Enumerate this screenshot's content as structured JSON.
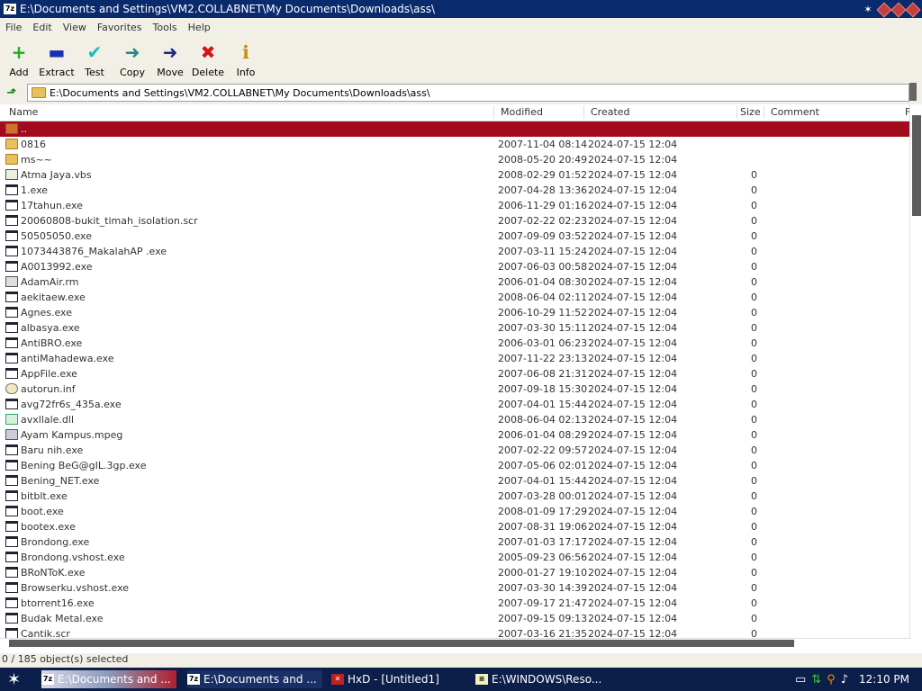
{
  "window": {
    "title": "E:\\Documents and Settings\\VM2.COLLABNET\\My Documents\\Downloads\\ass\\",
    "app_icon": "7z"
  },
  "menu": [
    "File",
    "Edit",
    "View",
    "Favorites",
    "Tools",
    "Help"
  ],
  "toolbar": [
    {
      "label": "Add",
      "icon": "+",
      "color": "#18b018"
    },
    {
      "label": "Extract",
      "icon": "▬",
      "color": "#1830b0"
    },
    {
      "label": "Test",
      "icon": "✔",
      "color": "#20b8b8"
    },
    {
      "label": "Copy",
      "icon": "➜",
      "color": "#208888"
    },
    {
      "label": "Move",
      "icon": "➜",
      "color": "#1a2a80"
    },
    {
      "label": "Delete",
      "icon": "✖",
      "color": "#d01818"
    },
    {
      "label": "Info",
      "icon": "ℹ",
      "color": "#c09000"
    }
  ],
  "address": {
    "path": "E:\\Documents and Settings\\VM2.COLLABNET\\My Documents\\Downloads\\ass\\"
  },
  "columns": {
    "name": "Name",
    "modified": "Modified",
    "created": "Created",
    "size": "Size",
    "comment": "Comment",
    "extra": "F"
  },
  "rows": [
    {
      "icon": "folder",
      "name": "..",
      "modified": "",
      "created": "",
      "size": ""
    },
    {
      "icon": "folder",
      "name": "0816",
      "modified": "2007-11-04 08:14",
      "created": "2024-07-15 12:04",
      "size": ""
    },
    {
      "icon": "folder",
      "name": "ms~~",
      "modified": "2008-05-20 20:49",
      "created": "2024-07-15 12:04",
      "size": ""
    },
    {
      "icon": "script",
      "name": " Atma Jaya.vbs",
      "modified": "2008-02-29 01:52",
      "created": "2024-07-15 12:04",
      "size": "0"
    },
    {
      "icon": "exe",
      "name": "1.exe",
      "modified": "2007-04-28 13:36",
      "created": "2024-07-15 12:04",
      "size": "0"
    },
    {
      "icon": "exe",
      "name": "17tahun.exe",
      "modified": "2006-11-29 01:16",
      "created": "2024-07-15 12:04",
      "size": "0"
    },
    {
      "icon": "exe",
      "name": "20060808-bukit_timah_isolation.scr",
      "modified": "2007-02-22 02:23",
      "created": "2024-07-15 12:04",
      "size": "0"
    },
    {
      "icon": "exe",
      "name": "50505050.exe",
      "modified": "2007-09-09 03:52",
      "created": "2024-07-15 12:04",
      "size": "0"
    },
    {
      "icon": "exe",
      "name": "1073443876_MakalahAP .exe",
      "modified": "2007-03-11 15:24",
      "created": "2024-07-15 12:04",
      "size": "0"
    },
    {
      "icon": "exe",
      "name": "A0013992.exe",
      "modified": "2007-06-03 00:58",
      "created": "2024-07-15 12:04",
      "size": "0"
    },
    {
      "icon": "rm",
      "name": "AdamAir.rm",
      "modified": "2006-01-04 08:30",
      "created": "2024-07-15 12:04",
      "size": "0"
    },
    {
      "icon": "exe",
      "name": "aekitaew.exe",
      "modified": "2008-06-04 02:11",
      "created": "2024-07-15 12:04",
      "size": "0"
    },
    {
      "icon": "exe",
      "name": "Agnes.exe",
      "modified": "2006-10-29 11:52",
      "created": "2024-07-15 12:04",
      "size": "0"
    },
    {
      "icon": "exe",
      "name": "albasya.exe",
      "modified": "2007-03-30 15:11",
      "created": "2024-07-15 12:04",
      "size": "0"
    },
    {
      "icon": "exe",
      "name": "AntiBRO.exe",
      "modified": "2006-03-01 06:23",
      "created": "2024-07-15 12:04",
      "size": "0"
    },
    {
      "icon": "exe",
      "name": "antiMahadewa.exe",
      "modified": "2007-11-22 23:13",
      "created": "2024-07-15 12:04",
      "size": "0"
    },
    {
      "icon": "exe",
      "name": "AppFile.exe",
      "modified": "2007-06-08 21:31",
      "created": "2024-07-15 12:04",
      "size": "0"
    },
    {
      "icon": "inf",
      "name": "autorun.inf",
      "modified": "2007-09-18 15:30",
      "created": "2024-07-15 12:04",
      "size": "0"
    },
    {
      "icon": "exe",
      "name": "avg72fr6s_435a.exe",
      "modified": "2007-04-01 15:44",
      "created": "2024-07-15 12:04",
      "size": "0"
    },
    {
      "icon": "dll",
      "name": "avxllale.dll",
      "modified": "2008-06-04 02:13",
      "created": "2024-07-15 12:04",
      "size": "0"
    },
    {
      "icon": "media",
      "name": "Ayam Kampus.mpeg",
      "modified": "2006-01-04 08:29",
      "created": "2024-07-15 12:04",
      "size": "0"
    },
    {
      "icon": "exe",
      "name": "Baru nih.exe",
      "modified": "2007-02-22 09:57",
      "created": "2024-07-15 12:04",
      "size": "0"
    },
    {
      "icon": "exe",
      "name": "Bening BeG@gIL.3gp.exe",
      "modified": "2007-05-06 02:01",
      "created": "2024-07-15 12:04",
      "size": "0"
    },
    {
      "icon": "exe",
      "name": "Bening_NET.exe",
      "modified": "2007-04-01 15:44",
      "created": "2024-07-15 12:04",
      "size": "0"
    },
    {
      "icon": "exe",
      "name": "bitblt.exe",
      "modified": "2007-03-28 00:01",
      "created": "2024-07-15 12:04",
      "size": "0"
    },
    {
      "icon": "exe",
      "name": "boot.exe",
      "modified": "2008-01-09 17:29",
      "created": "2024-07-15 12:04",
      "size": "0"
    },
    {
      "icon": "exe",
      "name": "bootex.exe",
      "modified": "2007-08-31 19:06",
      "created": "2024-07-15 12:04",
      "size": "0"
    },
    {
      "icon": "exe",
      "name": "Brondong.exe",
      "modified": "2007-01-03 17:17",
      "created": "2024-07-15 12:04",
      "size": "0"
    },
    {
      "icon": "exe",
      "name": "Brondong.vshost.exe",
      "modified": "2005-09-23 06:56",
      "created": "2024-07-15 12:04",
      "size": "0"
    },
    {
      "icon": "exe",
      "name": "BRoNToK.exe",
      "modified": "2000-01-27 19:10",
      "created": "2024-07-15 12:04",
      "size": "0"
    },
    {
      "icon": "exe",
      "name": "Browserku.vshost.exe",
      "modified": "2007-03-30 14:39",
      "created": "2024-07-15 12:04",
      "size": "0"
    },
    {
      "icon": "exe",
      "name": "btorrent16.exe",
      "modified": "2007-09-17 21:47",
      "created": "2024-07-15 12:04",
      "size": "0"
    },
    {
      "icon": "exe",
      "name": "Budak Metal.exe",
      "modified": "2007-09-15 09:13",
      "created": "2024-07-15 12:04",
      "size": "0"
    },
    {
      "icon": "exe",
      "name": "Cantik.scr",
      "modified": "2007-03-16 21:35",
      "created": "2024-07-15 12:04",
      "size": "0"
    }
  ],
  "status": "0 / 185 object(s) selected",
  "taskbar": {
    "tasks": [
      "E:\\Documents and ...",
      "E:\\Documents and ...",
      "HxD - [Untitled1]",
      "E:\\WINDOWS\\Reso..."
    ],
    "clock": "12:10 PM"
  }
}
